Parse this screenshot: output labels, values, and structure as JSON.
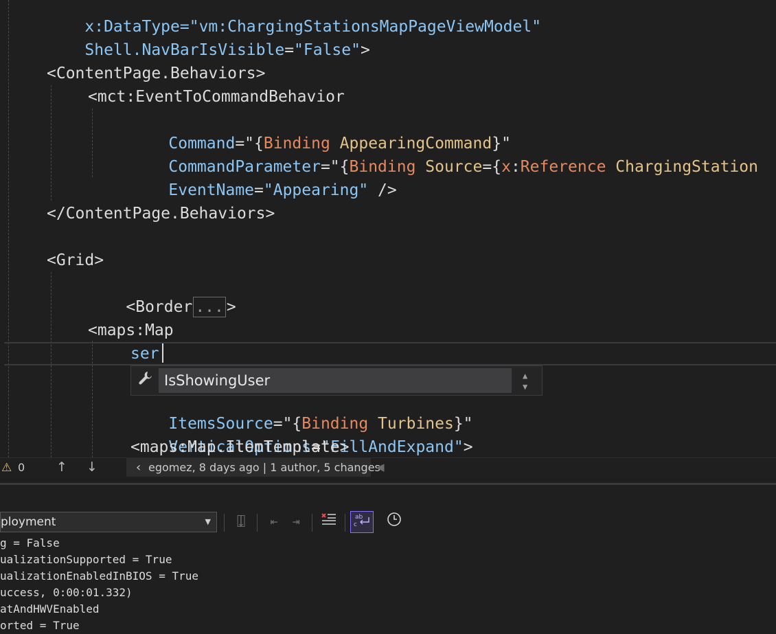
{
  "editor": {
    "lines": {
      "l0_a": "x:DataType=",
      "l0_b": "\"vm:ChargingStationsMapPageViewModel\"",
      "l1_a": "Shell.NavBarIsVisible",
      "l1_b": "=",
      "l1_c": "\"False\"",
      "l1_d": ">",
      "l3": "<ContentPage.Behaviors>",
      "l4": "<mct:EventToCommandBehavior",
      "l5_attr": "Command",
      "l5_eq": "=\"{",
      "l5_kw": "Binding",
      "l5_ref": " AppearingCommand",
      "l5_end": "}\"",
      "l6_attr": "CommandParameter",
      "l6_eq": "=\"{",
      "l6_kw": "Binding",
      "l6_ref": " Source",
      "l6_eq2": "={",
      "l6_x": "x",
      "l6_colon": ":",
      "l6_kw2": "Reference",
      "l6_ref2": " ChargingStation",
      "l7_attr": "EventName",
      "l7_eq": "=",
      "l7_val": "\"Appearing\"",
      "l7_end": " />",
      "l9": "</ContentPage.Behaviors>",
      "l11": "<Grid>",
      "l12_a": "<Border",
      "l12_collapsed": "...",
      "l12_b": ">",
      "l14": "<maps:Map",
      "l15": "ser",
      "l17_attr": "ItemsSource",
      "l17_eq": "=\"{",
      "l17_kw": "Binding",
      "l17_ref": " Turbines",
      "l17_end": "}\"",
      "l18_attr": "VerticalOptions",
      "l18_eq": "=",
      "l18_val": "\"FillAndExpand\"",
      "l18_end": ">",
      "l19": "<maps:Map.ItemTemplate>"
    },
    "completion": {
      "icon": "wrench-icon",
      "item": "IsShowingUser"
    }
  },
  "statusbar": {
    "warning_count": "0",
    "blame": "egomez, 8 days ago | 1 author, 5 changes"
  },
  "output": {
    "source_selected": "ployment",
    "lines": [
      "g = False",
      "ualizationSupported = True",
      "ualizationEnabledInBIOS = True",
      "uccess, 0:00:01.332)",
      "atAndHWVEnabled",
      "orted = True"
    ]
  },
  "colors": {
    "editor_bg": "#1f1f1f",
    "attribute": "#8cc6f5",
    "keyword": "#e6895f",
    "reference": "#e3c389",
    "selected_button_border": "#8a6fff"
  }
}
